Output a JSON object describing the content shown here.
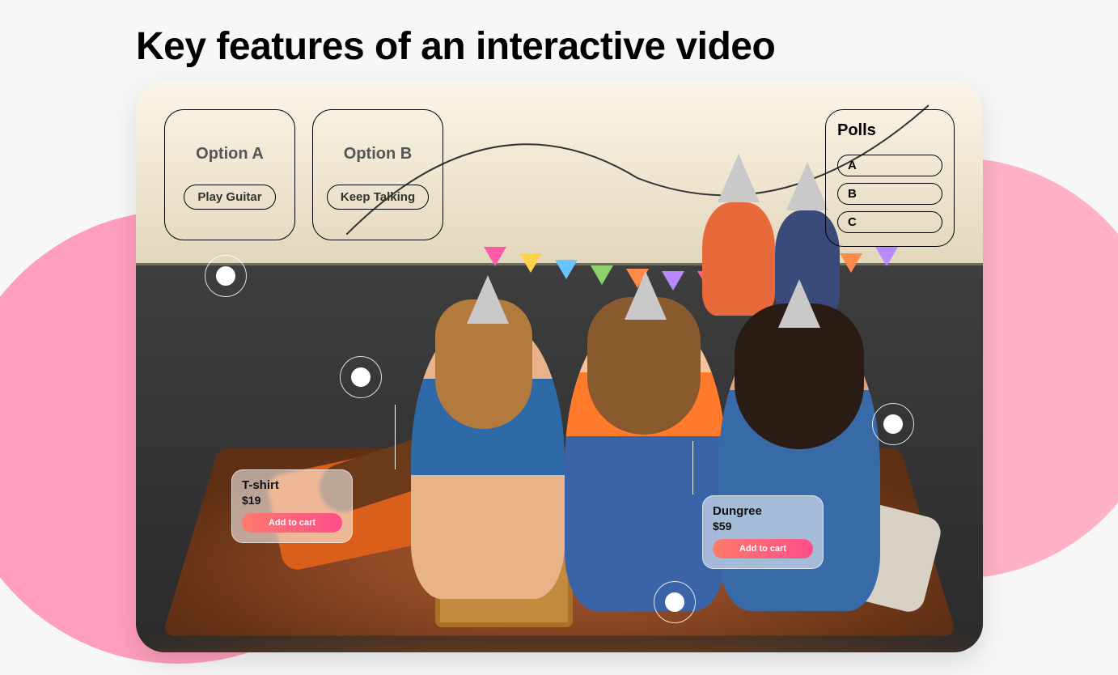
{
  "title": "Key features of an interactive video",
  "options": {
    "a": {
      "label": "Option A",
      "chip": "Play Guitar"
    },
    "b": {
      "label": "Option B",
      "chip": "Keep Talking"
    }
  },
  "polls": {
    "title": "Polls",
    "choices": [
      "A",
      "B",
      "C"
    ]
  },
  "products": {
    "p1": {
      "name": "T-shirt",
      "price": "$19",
      "cta": "Add to cart"
    },
    "p2": {
      "name": "Dungree",
      "price": "$59",
      "cta": "Add to cart"
    }
  },
  "flag_colors": [
    "#ff5aa6",
    "#ffd24a",
    "#67c6ff",
    "#8ad36a",
    "#ff8a4a",
    "#b98aff",
    "#ff5aa6",
    "#ffd24a",
    "#67c6ff",
    "#8ad36a",
    "#ff8a4a",
    "#b98aff"
  ]
}
